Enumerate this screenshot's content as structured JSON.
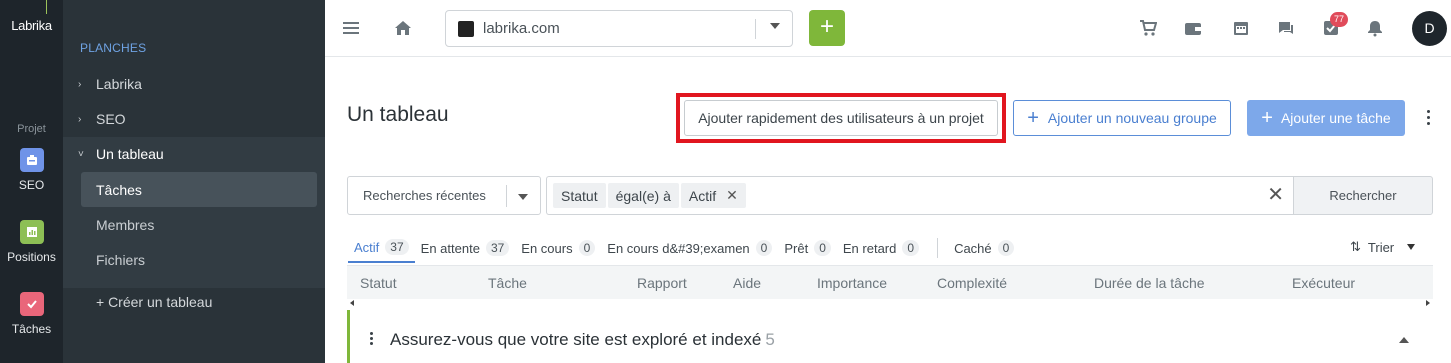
{
  "app": {
    "logo_text": "Labrika",
    "colors": {
      "accent": "#4a7fd0",
      "primary_green": "#7fb73a",
      "highlight_red": "#e1161f",
      "rail_bg": "#1e252b",
      "sidebar_bg": "#2a3339"
    }
  },
  "rail": {
    "section": "Projet",
    "items": [
      {
        "label": "SEO",
        "icon": "seo-icon",
        "color": "#6f93e8"
      },
      {
        "label": "Positions",
        "icon": "chart-icon",
        "color": "#8dbf55"
      },
      {
        "label": "Tâches",
        "icon": "check-icon",
        "color": "#e9667a"
      }
    ]
  },
  "sidebar": {
    "section": "PLANCHES",
    "items": [
      {
        "label": "Labrika",
        "chevron": "›"
      },
      {
        "label": "SEO",
        "chevron": "›"
      },
      {
        "label": "Un tableau",
        "chevron": "˅"
      }
    ],
    "subitems": [
      {
        "label": "Tâches"
      },
      {
        "label": "Membres"
      },
      {
        "label": "Fichiers"
      }
    ],
    "create_label": "+ Créer un tableau"
  },
  "topbar": {
    "site_value": "labrika.com",
    "add_label": "+",
    "notifications_badge": "77",
    "avatar_letter": "D"
  },
  "main": {
    "title": "Un tableau",
    "buttons": {
      "quick_add_users": "Ajouter rapidement des utilisateurs à un projet",
      "add_group": "Ajouter un nouveau groupe",
      "add_task": "Ajouter une tâche"
    },
    "search": {
      "recent_label": "Recherches récentes",
      "chips": [
        "Statut",
        "égal(e) à",
        "Actif"
      ],
      "search_button": "Rechercher"
    },
    "tabs": [
      {
        "label": "Actif",
        "count": "37"
      },
      {
        "label": "En attente",
        "count": "37"
      },
      {
        "label": "En cours",
        "count": "0"
      },
      {
        "label": "En cours d&#39;examen",
        "count": "0"
      },
      {
        "label": "Prêt",
        "count": "0"
      },
      {
        "label": "En retard",
        "count": "0"
      }
    ],
    "hidden_tab": {
      "label": "Caché",
      "count": "0"
    },
    "sort_label": "Trier",
    "columns": [
      "Statut",
      "Tâche",
      "Rapport",
      "Aide",
      "Importance",
      "Complexité",
      "Durée de la tâche",
      "Exécuteur"
    ],
    "group": {
      "title": "Assurez-vous que votre site est exploré et indexé",
      "count": "5"
    }
  }
}
